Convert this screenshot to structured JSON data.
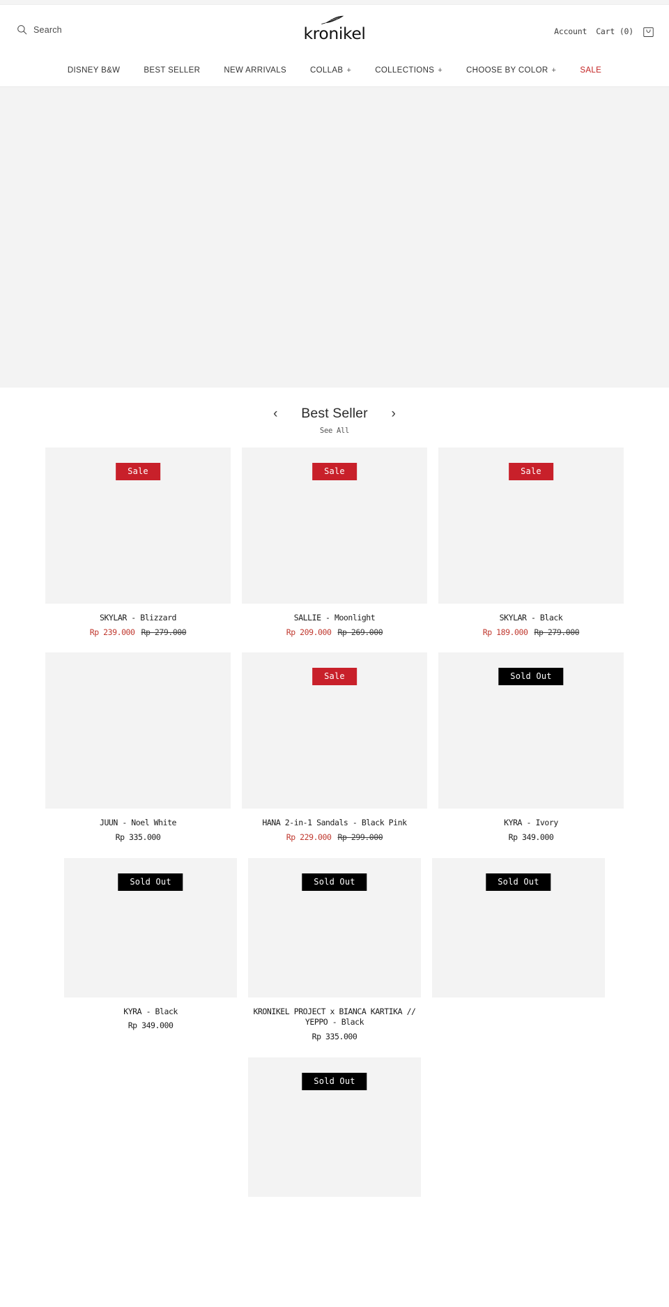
{
  "header": {
    "search": {
      "label": "Search",
      "icon": "search-icon"
    },
    "brand": {
      "wordmark": "kronikel",
      "icon": "quill-feather-icon"
    },
    "account_label": "Account",
    "cart_label": "Cart (0)",
    "cart_icon": "shopping-bag-icon"
  },
  "nav": {
    "items": [
      {
        "label": "DISNEY B&W",
        "expandable": false,
        "accent": false
      },
      {
        "label": "BEST SELLER",
        "expandable": false,
        "accent": false
      },
      {
        "label": "NEW ARRIVALS",
        "expandable": false,
        "accent": false
      },
      {
        "label": "COLLAB",
        "expandable": true,
        "accent": false
      },
      {
        "label": "COLLECTIONS",
        "expandable": true,
        "accent": false
      },
      {
        "label": "CHOOSE BY COLOR",
        "expandable": true,
        "accent": false
      },
      {
        "label": "SALE",
        "expandable": false,
        "accent": true
      }
    ],
    "expand_glyph": "+"
  },
  "colors": {
    "sale_red": "#c8202a",
    "price_red": "#c0392f",
    "nav_sale_red": "#c32222",
    "soldout_black": "#000000",
    "placeholder_grey": "#f3f3f3"
  },
  "section": {
    "title": "Best Seller",
    "see_all": "See All",
    "prev_glyph": "‹",
    "next_glyph": "›"
  },
  "products": [
    {
      "title": "SKYLAR - Blizzard",
      "badge": "Sale",
      "badge_type": "sale",
      "price": "Rp 239.000",
      "compare_price": "Rp 279.000",
      "discounted": true
    },
    {
      "title": "SALLIE - Moonlight",
      "badge": "Sale",
      "badge_type": "sale",
      "price": "Rp 209.000",
      "compare_price": "Rp 269.000",
      "discounted": true
    },
    {
      "title": "SKYLAR - Black",
      "badge": "Sale",
      "badge_type": "sale",
      "price": "Rp 189.000",
      "compare_price": "Rp 279.000",
      "discounted": true
    },
    {
      "title": "JUUN - Noel White",
      "badge": "",
      "badge_type": "none",
      "price": "Rp 335.000",
      "compare_price": "",
      "discounted": false
    },
    {
      "title": "HANA 2-in-1 Sandals - Black Pink",
      "badge": "Sale",
      "badge_type": "sale",
      "price": "Rp 229.000",
      "compare_price": "Rp 299.000",
      "discounted": true
    },
    {
      "title": "KYRA - Ivory",
      "badge": "Sold Out",
      "badge_type": "soldout",
      "price": "Rp 349.000",
      "compare_price": "",
      "discounted": false
    },
    {
      "title": "KYRA - Black",
      "badge": "Sold Out",
      "badge_type": "soldout",
      "price": "Rp 349.000",
      "compare_price": "",
      "discounted": false
    },
    {
      "title": "KRONIKEL PROJECT x BIANCA KARTIKA // YEPPO - Black",
      "badge": "Sold Out",
      "badge_type": "soldout",
      "price": "Rp 335.000",
      "compare_price": "",
      "discounted": false
    },
    {
      "title": "",
      "badge": "Sold Out",
      "badge_type": "soldout",
      "price": "",
      "compare_price": "",
      "discounted": false
    },
    {
      "title": "",
      "badge": "Sold Out",
      "badge_type": "soldout",
      "price": "",
      "compare_price": "",
      "discounted": false
    }
  ]
}
